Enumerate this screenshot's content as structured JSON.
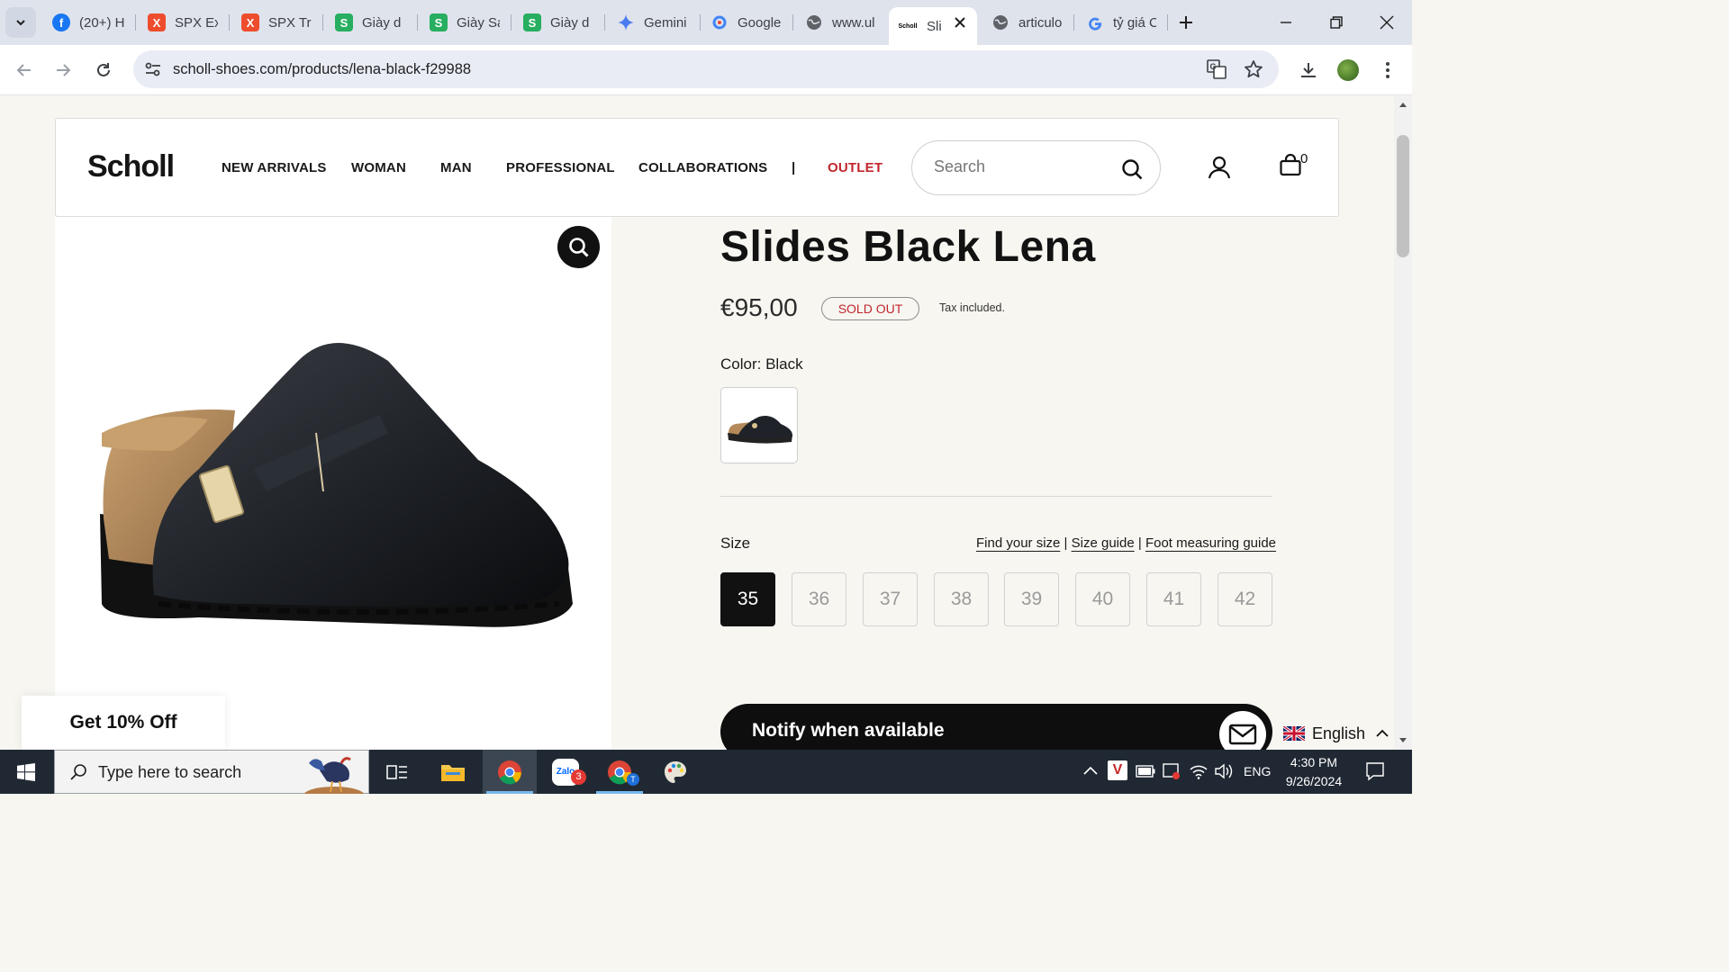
{
  "browser": {
    "tabs": [
      {
        "title": "(20+) H",
        "icon": "facebook-icon",
        "color": "#1877f2"
      },
      {
        "title": "SPX Ex",
        "icon": "spx-icon",
        "color": "#ee4d2d"
      },
      {
        "title": "SPX Tra",
        "icon": "spx-icon",
        "color": "#ee4d2d"
      },
      {
        "title": "Giày d",
        "icon": "s-app-icon",
        "color": "#27ae60"
      },
      {
        "title": "Giày Sa",
        "icon": "s-app-icon",
        "color": "#27ae60"
      },
      {
        "title": "Giày d",
        "icon": "s-app-icon",
        "color": "#27ae60"
      },
      {
        "title": "Gemini",
        "icon": "gemini-icon",
        "color": "#4285f4"
      },
      {
        "title": "Google",
        "icon": "google-lens-icon",
        "color": "#4285f4"
      },
      {
        "title": "www.ul",
        "icon": "globe-icon",
        "color": "#5f6368"
      },
      {
        "title": "Sli",
        "icon": "scholl-favicon",
        "color": "#000000",
        "favicon_text": "Scholl"
      },
      {
        "title": "articulo",
        "icon": "globe-icon",
        "color": "#5f6368"
      },
      {
        "title": "tỷ giá C",
        "icon": "google-icon",
        "color": "#4285f4"
      }
    ],
    "url": "scholl-shoes.com/products/lena-black-f29988"
  },
  "site": {
    "logo": "Scholl",
    "nav": [
      "NEW ARRIVALS",
      "WOMAN",
      "MAN",
      "PROFESSIONAL",
      "COLLABORATIONS",
      "|",
      "OUTLET"
    ],
    "outlet_color": "#c0272d",
    "search_placeholder": "Search",
    "cart_count": "0"
  },
  "product": {
    "title": "Slides Black Lena",
    "price": "€95,00",
    "status": "SOLD OUT",
    "tax_note": "Tax included.",
    "color_label": "Color: Black",
    "size_label": "Size",
    "guides": [
      "Find your size",
      "Size guide",
      "Foot measuring guide"
    ],
    "sizes": [
      "35",
      "36",
      "37",
      "38",
      "39",
      "40",
      "41",
      "42"
    ],
    "selected_size": "35",
    "notify_label": "Notify when available"
  },
  "promo": {
    "label": "Get 10% Off"
  },
  "language": {
    "label": "English"
  },
  "taskbar": {
    "search_placeholder": "Type here to search",
    "zalo_badge": "3",
    "lang": "ENG",
    "time": "4:30 PM",
    "date": "9/26/2024"
  }
}
